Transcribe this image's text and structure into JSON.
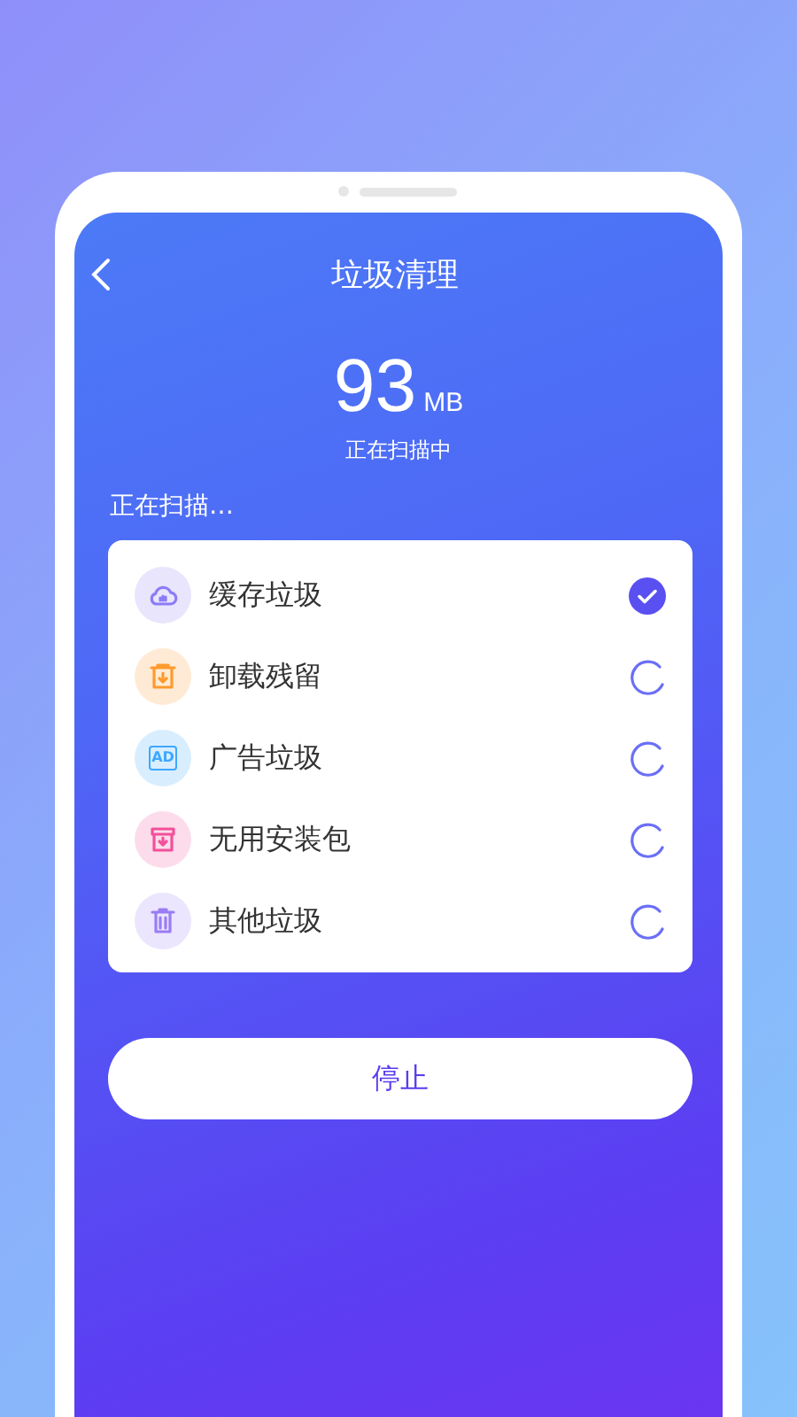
{
  "header": {
    "title": "垃圾清理"
  },
  "summary": {
    "amount": "93",
    "unit": "MB",
    "status": "正在扫描中"
  },
  "section_label": "正在扫描…",
  "items": [
    {
      "kind": "cloud",
      "label": "缓存垃圾",
      "color": "#8b7cf6",
      "done": true
    },
    {
      "kind": "uninstall",
      "label": "卸载残留",
      "color": "#ff9a2e",
      "done": false
    },
    {
      "kind": "ad",
      "label": "广告垃圾",
      "color": "#3ea8ff",
      "done": false,
      "icon_text": "AD"
    },
    {
      "kind": "package",
      "label": "无用安装包",
      "color": "#f2509a",
      "done": false
    },
    {
      "kind": "trash",
      "label": "其他垃圾",
      "color": "#9a7cf6",
      "done": false
    }
  ],
  "stop_button": "停止"
}
